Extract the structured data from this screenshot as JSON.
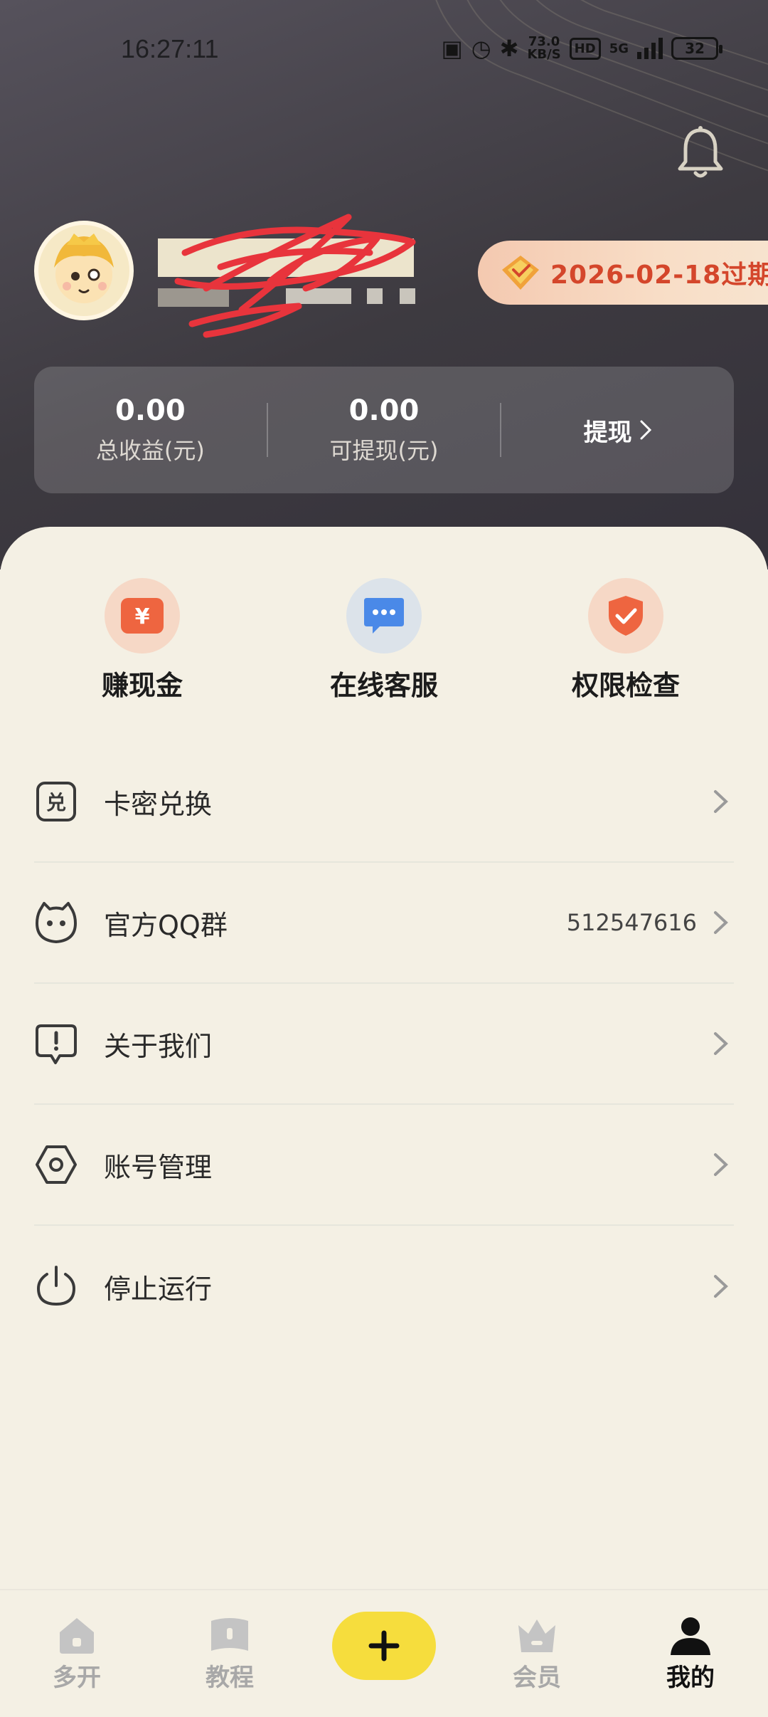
{
  "status_bar": {
    "time": "16:27:11",
    "net_speed_value": "73.0",
    "net_speed_unit": "KB/S",
    "hd_label": "HD",
    "signal_label": "5G",
    "battery": "32"
  },
  "user": {
    "name": "██ ██",
    "id": "██ ███ ██",
    "vip_expiry": "2026-02-18过期"
  },
  "earnings": {
    "total_value": "0.00",
    "total_label": "总收益(元)",
    "withdrawable_value": "0.00",
    "withdrawable_label": "可提现(元)",
    "withdraw_button": "提现"
  },
  "quick_actions": [
    {
      "label": "赚现金",
      "icon": "yen-coin-icon"
    },
    {
      "label": "在线客服",
      "icon": "chat-bubble-icon"
    },
    {
      "label": "权限检查",
      "icon": "shield-check-icon"
    }
  ],
  "menu": [
    {
      "label": "卡密兑换",
      "value": "",
      "icon": "redeem-card-icon"
    },
    {
      "label": "官方QQ群",
      "value": "512547616",
      "icon": "qq-face-icon"
    },
    {
      "label": "关于我们",
      "value": "",
      "icon": "info-bubble-icon"
    },
    {
      "label": "账号管理",
      "value": "",
      "icon": "hex-settings-icon"
    },
    {
      "label": "停止运行",
      "value": "",
      "icon": "power-icon"
    }
  ],
  "tabs": [
    {
      "label": "多开",
      "icon": "home-icon",
      "active": false
    },
    {
      "label": "教程",
      "icon": "book-icon",
      "active": false
    },
    {
      "label": "会员",
      "icon": "crown-icon",
      "active": false
    },
    {
      "label": "我的",
      "icon": "person-icon",
      "active": true
    }
  ],
  "colors": {
    "accent_yellow": "#f6dd3d",
    "vip_text": "#d4462b",
    "header_dark": "#3d3a40",
    "panel_bg": "#f4f0e4"
  }
}
